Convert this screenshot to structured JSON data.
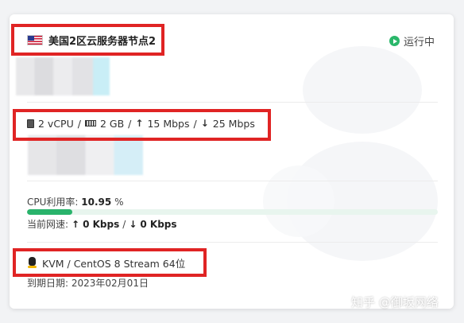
{
  "server": {
    "name": "美国2区云服务器节点2",
    "status": "运行中",
    "country_flag": "us-flag-icon"
  },
  "specs": {
    "cpu": "2 vCPU",
    "ram": "2 GB",
    "upload": "15 Mbps",
    "download": "25 Mbps",
    "separator": "/"
  },
  "usage": {
    "cpu_label": "CPU利用率:",
    "cpu_value": "10.95",
    "cpu_unit": "%",
    "cpu_fraction": 0.1095,
    "net_label": "当前网速:",
    "net_up": "0 Kbps",
    "net_down": "0 Kbps"
  },
  "system": {
    "os": "KVM / CentOS 8 Stream 64位",
    "expire_label": "到期日期:",
    "expire_date": "2023年02月01日"
  },
  "watermark": "知乎 @御坂网络",
  "colors": {
    "status_green": "#2ab76a",
    "progress_fill": "#29b36b",
    "highlight_red": "#e02424"
  }
}
